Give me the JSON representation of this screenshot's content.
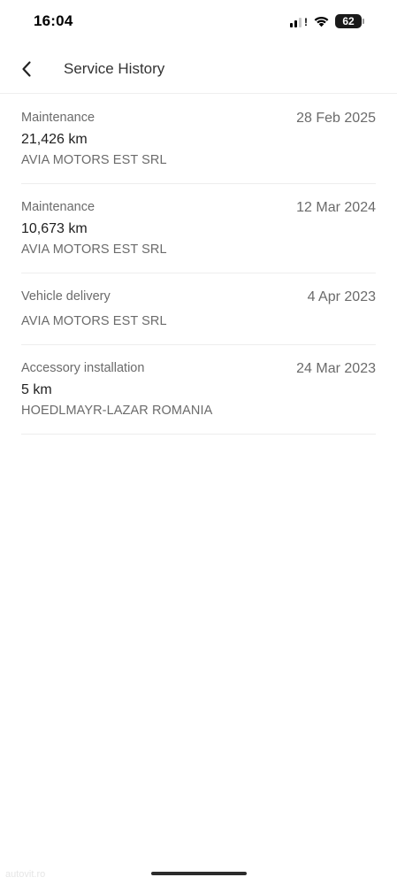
{
  "status_bar": {
    "time": "16:04",
    "battery": "62",
    "icons": [
      "signal-icon",
      "wifi-icon",
      "battery-icon"
    ]
  },
  "header": {
    "back_icon": "chevron-left-icon",
    "title": "Service History"
  },
  "history": [
    {
      "type": "Maintenance",
      "date": "28 Feb 2025",
      "km": "21,426 km",
      "dealer": "AVIA MOTORS EST SRL"
    },
    {
      "type": "Maintenance",
      "date": "12 Mar 2024",
      "km": "10,673 km",
      "dealer": "AVIA MOTORS EST SRL"
    },
    {
      "type": "Vehicle delivery",
      "date": "4 Apr 2023",
      "km": "",
      "dealer": "AVIA MOTORS EST SRL"
    },
    {
      "type": "Accessory installation",
      "date": "24 Mar 2023",
      "km": "5 km",
      "dealer": "HOEDLMAYR-LAZAR ROMANIA"
    }
  ],
  "watermark": "autovit.ro"
}
